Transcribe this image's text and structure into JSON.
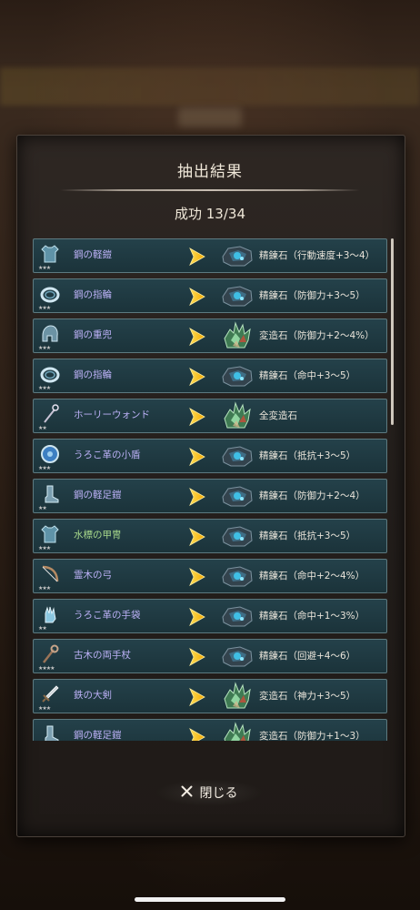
{
  "dialog": {
    "title": "抽出結果",
    "success_text": "成功 13/34",
    "close_label": "閉じる"
  },
  "rows": [
    {
      "name": "鋼の軽鎧",
      "stars": "★★★",
      "name_color": "purple",
      "item_icon": "armor-icon",
      "result_icon": "refine-stone-icon",
      "result": "精錬石（行動速度+3～4）"
    },
    {
      "name": "鋼の指輪",
      "stars": "★★★",
      "name_color": "purple",
      "item_icon": "ring-icon",
      "result_icon": "refine-stone-icon",
      "result": "精錬石（防御力+3～5）"
    },
    {
      "name": "鋼の重兜",
      "stars": "★★★",
      "name_color": "purple",
      "item_icon": "helmet-icon",
      "result_icon": "transform-stone-icon",
      "result": "変造石（防御力+2～4%）"
    },
    {
      "name": "鋼の指輪",
      "stars": "★★★",
      "name_color": "purple",
      "item_icon": "ring-icon",
      "result_icon": "refine-stone-icon",
      "result": "精錬石（命中+3～5）"
    },
    {
      "name": "ホーリーウォンド",
      "stars": "★★",
      "name_color": "purple",
      "item_icon": "wand-icon",
      "result_icon": "transform-stone-icon",
      "result": "全変造石"
    },
    {
      "name": "うろこ革の小盾",
      "stars": "★★★",
      "name_color": "purple",
      "item_icon": "shield-icon",
      "result_icon": "refine-stone-icon",
      "result": "精錬石（抵抗+3～5）"
    },
    {
      "name": "鋼の軽足鎧",
      "stars": "★★",
      "name_color": "purple",
      "item_icon": "boots-icon",
      "result_icon": "refine-stone-icon",
      "result": "精錬石（防御力+2～4）"
    },
    {
      "name": "水標の甲冑",
      "stars": "★★★",
      "name_color": "green",
      "item_icon": "armor-icon",
      "result_icon": "refine-stone-icon",
      "result": "精錬石（抵抗+3～5）"
    },
    {
      "name": "霊木の弓",
      "stars": "★★★",
      "name_color": "purple",
      "item_icon": "bow-icon",
      "result_icon": "refine-stone-icon",
      "result": "精錬石（命中+2～4%）"
    },
    {
      "name": "うろこ革の手袋",
      "stars": "★★",
      "name_color": "purple",
      "item_icon": "glove-icon",
      "result_icon": "refine-stone-icon",
      "result": "精錬石（命中+1～3%）"
    },
    {
      "name": "古木の両手杖",
      "stars": "★★★★",
      "name_color": "purple",
      "item_icon": "staff-icon",
      "result_icon": "refine-stone-icon",
      "result": "精錬石（回避+4～6）"
    },
    {
      "name": "鉄の大剣",
      "stars": "★★★",
      "name_color": "purple",
      "item_icon": "sword-icon",
      "result_icon": "transform-stone-icon",
      "result": "変造石（神力+3～5）"
    },
    {
      "name": "鋼の軽足鎧",
      "stars": "★★",
      "name_color": "purple",
      "item_icon": "boots-icon",
      "result_icon": "transform-stone-icon",
      "result": "変造石（防御力+1～3）"
    }
  ],
  "colors": {
    "row_bg": "#1f3a42",
    "name_purple": "#bcb1f7",
    "name_green": "#a8d98b",
    "arrow": "#f5b400"
  }
}
